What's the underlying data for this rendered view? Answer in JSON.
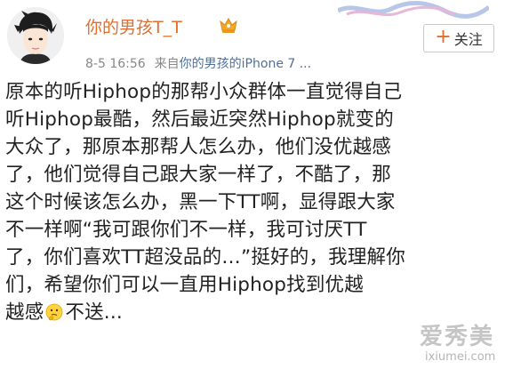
{
  "post": {
    "username": "你的男孩T_T",
    "follow_button": {
      "icon": "+",
      "label": "关注"
    },
    "meta": {
      "time": "8-5 16:56",
      "source_prefix": "来自",
      "source_name": "你的男孩的iPhone 7 ..."
    },
    "content_lines": [
      "原本的听Hiphop的那帮小众群体一直觉得自己",
      "听Hiphop最酷，然后最近突然Hiphop就变的",
      "大众了，那原本那帮人怎么办，他们没优越感",
      "了，他们觉得自己跟大家一样了，不酷了，那",
      "这个时候该怎么办，黑一下TT啊，显得跟大家",
      "不一样啊“我可跟你们不一样，我可讨厌TT",
      "了，你们喜欢TT超没品的…”挺好的，我理解你",
      "们，希望你们可以一直用Hiphop找到优越"
    ],
    "last_line": {
      "before_emoji": "越感",
      "emoji_icon": "thinking-emoji",
      "after_emoji": "不送..."
    }
  },
  "watermark": {
    "text": "爱秀美",
    "url": "ixiumei.com"
  },
  "colors": {
    "username": "#e16f2e",
    "meta": "#888888",
    "source_link": "#50709a",
    "text": "#222222",
    "border": "#c9c9c9"
  }
}
